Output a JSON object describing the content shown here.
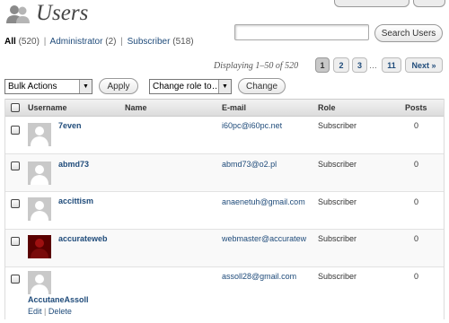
{
  "header": {
    "title": "Users",
    "icon": "users-icon"
  },
  "filters": {
    "all_label": "All",
    "all_count": "(520)",
    "admin_label": "Administrator",
    "admin_count": "(2)",
    "subscriber_label": "Subscriber",
    "subscriber_count": "(518)",
    "separator": "|"
  },
  "search": {
    "value": "",
    "button_label": "Search Users"
  },
  "pagination": {
    "displaying": "Displaying 1–50 of 520",
    "pages": [
      "1",
      "2",
      "3"
    ],
    "current_page": "1",
    "ellipsis": "…",
    "last_page": "11",
    "next_label": "Next »"
  },
  "actions": {
    "bulk_select": "Bulk Actions",
    "apply_label": "Apply",
    "role_select": "Change role to…",
    "change_label": "Change"
  },
  "table": {
    "columns": {
      "username": "Username",
      "name": "Name",
      "email": "E-mail",
      "role": "Role",
      "posts": "Posts"
    },
    "rows": [
      {
        "username": "7even",
        "name": "",
        "email": "i60pc@i60pc.net",
        "role": "Subscriber",
        "posts": "0",
        "avatar": "default"
      },
      {
        "username": "abmd73",
        "name": "",
        "email": "abmd73@o2.pl",
        "role": "Subscriber",
        "posts": "0",
        "avatar": "default"
      },
      {
        "username": "accittism",
        "name": "",
        "email": "anaenetuh@gmail.com",
        "role": "Subscriber",
        "posts": "0",
        "avatar": "default"
      },
      {
        "username": "accurateweb",
        "name": "",
        "email": "webmaster@accuratew",
        "role": "Subscriber",
        "posts": "0",
        "avatar": "custom-dark-red"
      },
      {
        "username": "AccutaneAssoll",
        "name": "",
        "email": "assoll28@gmail.com",
        "role": "Subscriber",
        "posts": "0",
        "avatar": "default",
        "row_actions": {
          "edit": "Edit",
          "sep": "|",
          "delete": "Delete"
        }
      }
    ]
  },
  "colors": {
    "link": "#1f4b7a",
    "header_bg": "#dcdcdc",
    "current_page_bg": "#c8c8c8"
  }
}
